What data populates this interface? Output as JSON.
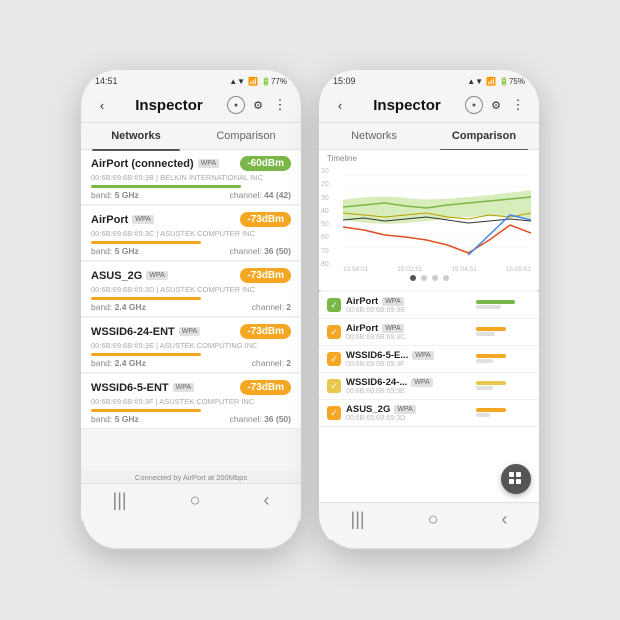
{
  "left_phone": {
    "status_time": "14:51",
    "status_icons": "▲▼ 77%",
    "app_bar": {
      "back_label": "‹",
      "title": "Inspector",
      "dot_label": "●",
      "tune_label": "≡",
      "more_label": "⋮"
    },
    "tabs": [
      {
        "label": "Networks",
        "active": true
      },
      {
        "label": "Comparison",
        "active": false
      }
    ],
    "networks": [
      {
        "name": "AirPort (connected)",
        "badge": "WPA",
        "mac": "00:6B:69:6B:69:3B | BELKIN INTERNATIONAL INC",
        "signal": "-60dBm",
        "signal_class": "green",
        "band": "5 GHz",
        "channel": "44 (42)",
        "bar_width": "75",
        "bar_class": "bar-green"
      },
      {
        "name": "AirPort",
        "badge": "WPA",
        "mac": "00:6B:69:6B:69:3C | ASUSTEK COMPUTER INC",
        "signal": "-73dBm",
        "signal_class": "orange",
        "band": "5 GHz",
        "channel": "36 (50)",
        "bar_width": "55",
        "bar_class": "bar-orange"
      },
      {
        "name": "ASUS_2G",
        "badge": "WPA",
        "mac": "00:6B:69:6B:69:3D | ASUSTEK COMPUTER INC",
        "signal": "-73dBm",
        "signal_class": "orange",
        "band": "2.4 GHz",
        "channel": "2",
        "bar_width": "55",
        "bar_class": "bar-orange"
      },
      {
        "name": "WSSID6-24-ENT",
        "badge": "WPA",
        "mac": "00:6B:69:6B:69:3E | ASUSTEK COMPUTING INC",
        "signal": "-73dBm",
        "signal_class": "orange",
        "band": "2.4 GHz",
        "channel": "2",
        "bar_width": "55",
        "bar_class": "bar-orange"
      },
      {
        "name": "WSSID6-5-ENT",
        "badge": "WPA",
        "mac": "00:6B:69:6B:69:3F | ASUSTEK COMPUTER INC",
        "signal": "-73dBm",
        "signal_class": "orange",
        "band": "5 GHz",
        "channel": "36 (50)",
        "bar_width": "55",
        "bar_class": "bar-orange"
      }
    ],
    "connected_note": "Connected by AirPort at 200Mbps",
    "bottom_nav": [
      "|||",
      "○",
      "‹"
    ]
  },
  "right_phone": {
    "status_time": "15:09",
    "status_icons": "▲▼ 75%",
    "app_bar": {
      "back_label": "‹",
      "title": "Inspector",
      "dot_label": "●",
      "tune_label": "≡",
      "more_label": "⋮"
    },
    "tabs": [
      {
        "label": "Networks",
        "active": false
      },
      {
        "label": "Comparison",
        "active": true
      }
    ],
    "chart": {
      "title": "Timeline",
      "y_labels": [
        "10",
        "20",
        "30",
        "40",
        "50",
        "60",
        "70",
        "80"
      ],
      "x_labels": [
        "13:58:01",
        "15:02:51",
        "15:04:51",
        "15:05:51"
      ]
    },
    "comp_items": [
      {
        "name": "AirPort",
        "badge": "WPA",
        "mac": "00:6B:69:6B:69:3B",
        "bar1_width": 70,
        "bar1_color": "#7ab648",
        "bar2_width": 45,
        "bar2_color": "#e0e0e0",
        "checked": true,
        "check_color": "#7ab648"
      },
      {
        "name": "AirPort",
        "badge": "WPA",
        "mac": "00:6B:69:6B:69:3C",
        "bar1_width": 55,
        "bar1_color": "#f5a623",
        "bar2_width": 35,
        "bar2_color": "#e0e0e0",
        "checked": true,
        "check_color": "#f5a623"
      },
      {
        "name": "WSSID6-5-E...",
        "badge": "WPA",
        "mac": "00:6B:69:6B:69:3F",
        "bar1_width": 55,
        "bar1_color": "#f5a623",
        "bar2_width": 30,
        "bar2_color": "#e0e0e0",
        "checked": true,
        "check_color": "#f5a623"
      },
      {
        "name": "WSSID6-24-...",
        "badge": "WPA",
        "mac": "00:6B:69:6B:69:3E",
        "bar1_width": 55,
        "bar1_color": "#e8c84a",
        "bar2_width": 30,
        "bar2_color": "#e0e0e0",
        "checked": true,
        "check_color": "#e8c84a"
      },
      {
        "name": "ASUS_2G",
        "badge": "WPA",
        "mac": "00:6B:69:6B:69:3D",
        "bar1_width": 55,
        "bar1_color": "#f5a623",
        "bar2_width": 25,
        "bar2_color": "#e0e0e0",
        "checked": true,
        "check_color": "#f5a623"
      }
    ],
    "bottom_nav": [
      "|||",
      "○",
      "‹"
    ]
  }
}
